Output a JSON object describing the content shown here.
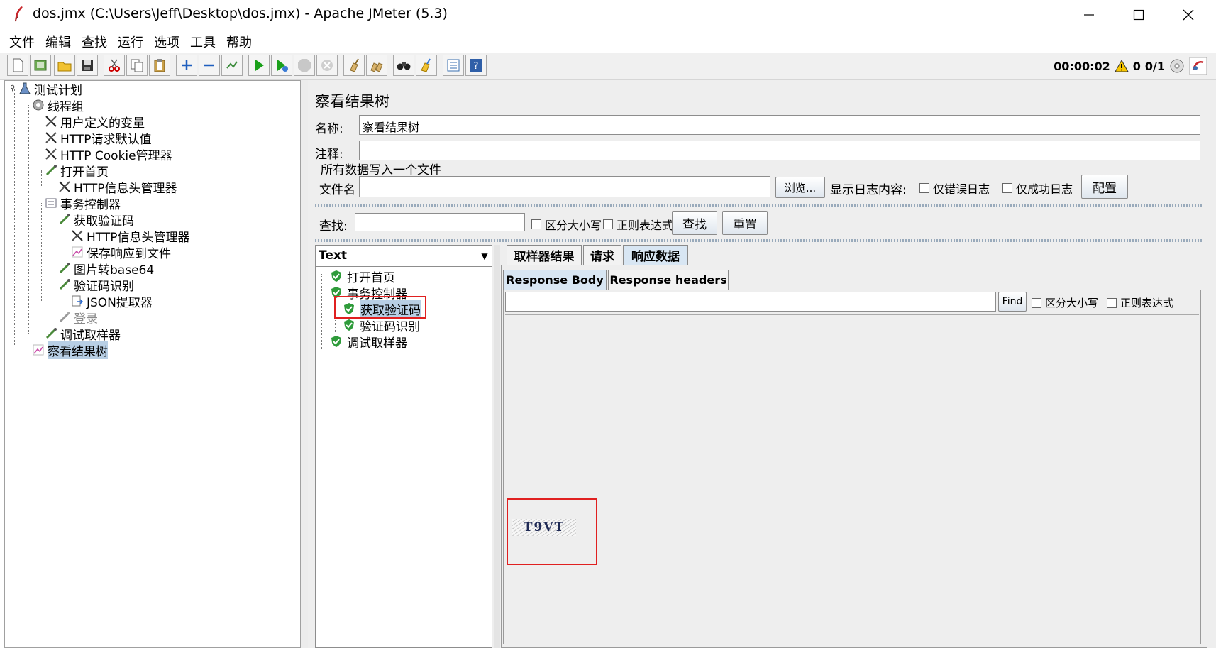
{
  "window": {
    "title": "dos.jmx (C:\\Users\\Jeff\\Desktop\\dos.jmx) - Apache JMeter (5.3)"
  },
  "menu": [
    "文件",
    "编辑",
    "查找",
    "运行",
    "选项",
    "工具",
    "帮助"
  ],
  "status": {
    "elapsed": "00:00:02",
    "warnings": "0",
    "threads": "0/1"
  },
  "tree": [
    {
      "label": "测试计划",
      "icon": "test-plan-icon"
    },
    {
      "label": "线程组",
      "icon": "gear-icon"
    },
    {
      "label": "用户定义的变量",
      "icon": "wrench-icon"
    },
    {
      "label": "HTTP请求默认值",
      "icon": "wrench-icon"
    },
    {
      "label": "HTTP Cookie管理器",
      "icon": "wrench-icon"
    },
    {
      "label": "打开首页",
      "icon": "pipette-icon"
    },
    {
      "label": "HTTP信息头管理器",
      "icon": "wrench-icon"
    },
    {
      "label": "事务控制器",
      "icon": "controller-icon"
    },
    {
      "label": "获取验证码",
      "icon": "pipette-icon"
    },
    {
      "label": "HTTP信息头管理器",
      "icon": "wrench-icon"
    },
    {
      "label": "保存响应到文件",
      "icon": "chart-icon"
    },
    {
      "label": "图片转base64",
      "icon": "pipette-icon"
    },
    {
      "label": "验证码识别",
      "icon": "pipette-icon"
    },
    {
      "label": "JSON提取器",
      "icon": "extractor-icon"
    },
    {
      "label": "登录",
      "icon": "pipette-icon",
      "disabled": true
    },
    {
      "label": "调试取样器",
      "icon": "pipette-icon"
    },
    {
      "label": "察看结果树",
      "icon": "chart-icon",
      "selected": true
    }
  ],
  "panel": {
    "title": "察看结果树",
    "name_label": "名称:",
    "name_value": "察看结果树",
    "comment_label": "注释:",
    "comment_value": "",
    "file_section": "所有数据写入一个文件",
    "filename_label": "文件名",
    "filename_value": "",
    "browse_button": "浏览...",
    "log_label": "显示日志内容:",
    "errors_only": "仅错误日志",
    "success_only": "仅成功日志",
    "config_button": "配置",
    "search_label": "查找:",
    "search_value": "",
    "case_sensitive": "区分大小写",
    "regex": "正则表达式",
    "find_button": "查找",
    "reset_button": "重置"
  },
  "renderer": {
    "selected": "Text"
  },
  "results": [
    {
      "label": "打开首页"
    },
    {
      "label": "事务控制器"
    },
    {
      "label": "获取验证码",
      "selected": true
    },
    {
      "label": "验证码识别"
    },
    {
      "label": "调试取样器"
    }
  ],
  "result_tabs": [
    "取样器结果",
    "请求",
    "响应数据"
  ],
  "active_result_tab": "响应数据",
  "response_tabs": [
    "Response Body",
    "Response headers"
  ],
  "active_response_tab": "Response Body",
  "response": {
    "find_button": "Find",
    "find_value": "",
    "case_sensitive": "区分大小写",
    "regex": "正则表达式",
    "captcha_text": "T9VT"
  }
}
